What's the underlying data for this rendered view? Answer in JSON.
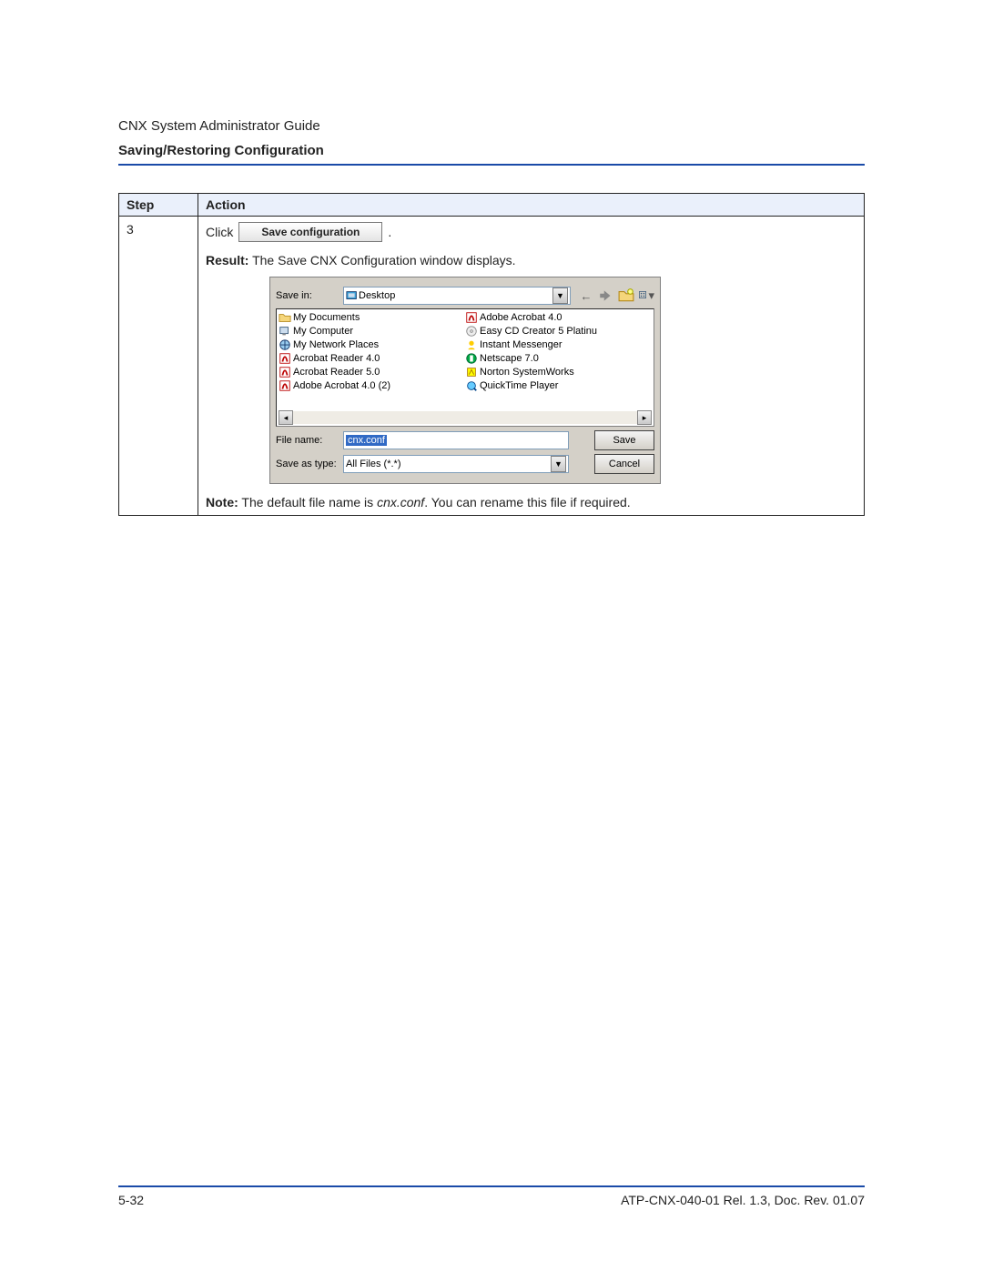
{
  "header": {
    "guide_title": "CNX System Administrator Guide",
    "section_title": "Saving/Restoring Configuration"
  },
  "table": {
    "col_step": "Step",
    "col_action": "Action",
    "step_num": "3",
    "click_label": "Click",
    "save_conf_btn": "Save configuration",
    "period": ".",
    "result_prefix": "Result:",
    "result_text": " The Save CNX Configuration window displays.",
    "note_prefix": "Note:",
    "note_text_a": " The default file name is ",
    "note_filename": "cnx.conf",
    "note_text_b": ". You can rename this file if required."
  },
  "dialog": {
    "save_in_label": "Save in:",
    "save_in_value": "Desktop",
    "files_col1": [
      "My Documents",
      "My Computer",
      "My Network Places",
      "Acrobat Reader 4.0",
      "Acrobat Reader 5.0",
      "Adobe Acrobat 4.0 (2)"
    ],
    "files_col2": [
      "Adobe Acrobat 4.0",
      "Easy CD Creator 5 Platinu",
      "Instant Messenger",
      "Netscape 7.0",
      "Norton SystemWorks",
      "QuickTime Player"
    ],
    "file_name_label": "File name:",
    "file_name_value": "cnx.conf",
    "save_type_label": "Save as type:",
    "save_type_value": "All Files (*.*)",
    "save_btn": "Save",
    "cancel_btn": "Cancel"
  },
  "footer": {
    "page_num": "5-32",
    "doc_id": "ATP-CNX-040-01 Rel. 1.3, Doc. Rev. 01.07"
  }
}
